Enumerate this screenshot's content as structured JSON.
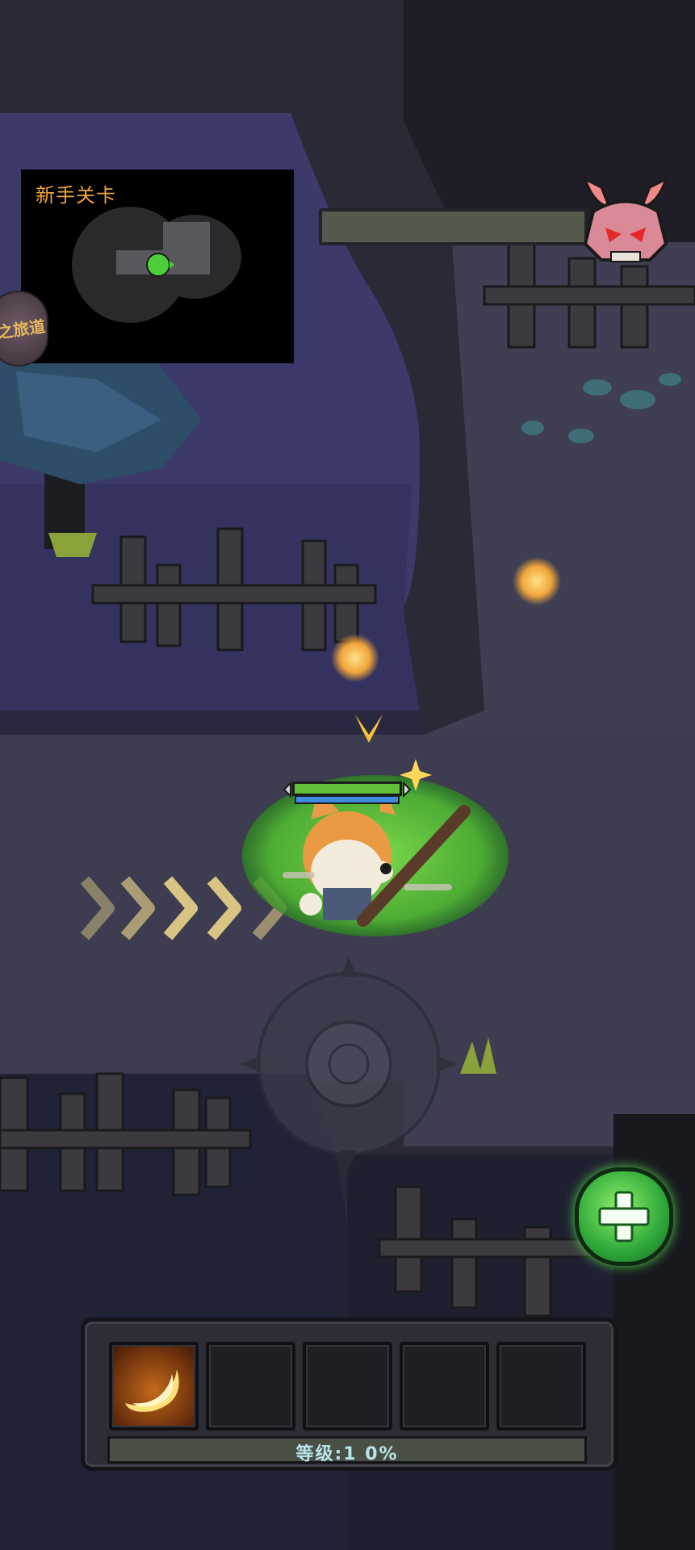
{
  "minimap": {
    "title": "新手关卡"
  },
  "side_badge": {
    "label": "之旅道"
  },
  "hud": {
    "boss_health_icon": "demon-skull-icon",
    "boss_health_fraction": 0,
    "player_health_fraction": 1.0,
    "player_shield_fraction": 1.0
  },
  "skill_bar": {
    "slots": [
      {
        "icon": "crescent-slash-icon",
        "filled": true
      },
      {
        "icon": "",
        "filled": false
      },
      {
        "icon": "",
        "filled": false
      },
      {
        "icon": "",
        "filled": false
      },
      {
        "icon": "",
        "filled": false
      }
    ],
    "level_label": "等级:1 0%"
  },
  "heal_button": {
    "icon": "plus-icon"
  },
  "colors": {
    "accent_orange": "#f0a53a",
    "heal_green": "#3cc24a",
    "hp_green": "#5fbf3a",
    "shield_blue": "#3f8be0"
  }
}
